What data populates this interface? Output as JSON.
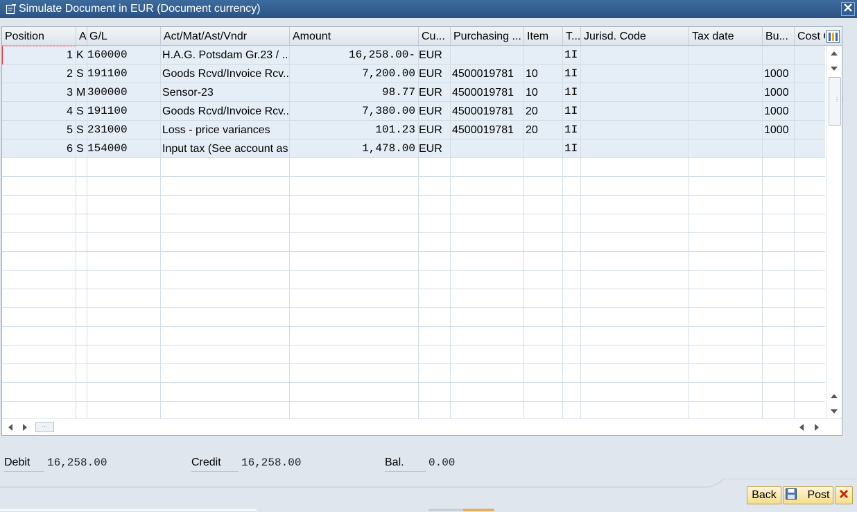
{
  "window": {
    "title": "Simulate Document in EUR (Document currency)"
  },
  "table": {
    "columns": [
      "Position",
      "A",
      "G/L",
      "Act/Mat/Ast/Vndr",
      "Amount",
      "Cu...",
      "Purchasing ...",
      "Item",
      "T...",
      "Jurisd. Code",
      "Tax date",
      "Bu...",
      "Cost C"
    ],
    "rows": [
      {
        "position": "1",
        "a": "K",
        "gl": "160000",
        "account": "H.A.G. Potsdam Gr.23 / ...",
        "amount": "16,258.00-",
        "currency": "EUR",
        "purchasing": "",
        "item": "",
        "tax": "1I",
        "jurisd": "",
        "taxdate": "",
        "bu": "",
        "cost": ""
      },
      {
        "position": "2",
        "a": "S",
        "gl": "191100",
        "account": "Goods Rcvd/Invoice Rcv...",
        "amount": "7,200.00",
        "currency": "EUR",
        "purchasing": "4500019781",
        "item": "10",
        "tax": "1I",
        "jurisd": "",
        "taxdate": "",
        "bu": "1000",
        "cost": ""
      },
      {
        "position": "3",
        "a": "M",
        "gl": "300000",
        "account": "Sensor-23",
        "amount": "98.77",
        "currency": "EUR",
        "purchasing": "4500019781",
        "item": "10",
        "tax": "1I",
        "jurisd": "",
        "taxdate": "",
        "bu": "1000",
        "cost": ""
      },
      {
        "position": "4",
        "a": "S",
        "gl": "191100",
        "account": "Goods Rcvd/Invoice Rcv...",
        "amount": "7,380.00",
        "currency": "EUR",
        "purchasing": "4500019781",
        "item": "20",
        "tax": "1I",
        "jurisd": "",
        "taxdate": "",
        "bu": "1000",
        "cost": ""
      },
      {
        "position": "5",
        "a": "S",
        "gl": "231000",
        "account": "Loss - price variances",
        "amount": "101.23",
        "currency": "EUR",
        "purchasing": "4500019781",
        "item": "20",
        "tax": "1I",
        "jurisd": "",
        "taxdate": "",
        "bu": "1000",
        "cost": ""
      },
      {
        "position": "6",
        "a": "S",
        "gl": "154000",
        "account": "Input tax (See account as...",
        "amount": "1,478.00",
        "currency": "EUR",
        "purchasing": "",
        "item": "",
        "tax": "1I",
        "jurisd": "",
        "taxdate": "",
        "bu": "",
        "cost": ""
      }
    ]
  },
  "totals": {
    "debit_label": "Debit",
    "debit_value": "16,258.00",
    "credit_label": "Credit",
    "credit_value": "16,258.00",
    "balance_label": "Bal.",
    "balance_value": "0.00"
  },
  "buttons": {
    "back": "Back",
    "post": "Post"
  },
  "icons": {
    "title": "edit-document-icon",
    "close_window": "close-icon",
    "column_settings": "column-settings-icon",
    "post": "save-icon",
    "cancel": "cancel-icon"
  },
  "colors": {
    "titlebar": "#2a5384",
    "row_fill": "#e5eef6",
    "button": "#f4dd8a",
    "cancel_x": "#cc2200"
  }
}
